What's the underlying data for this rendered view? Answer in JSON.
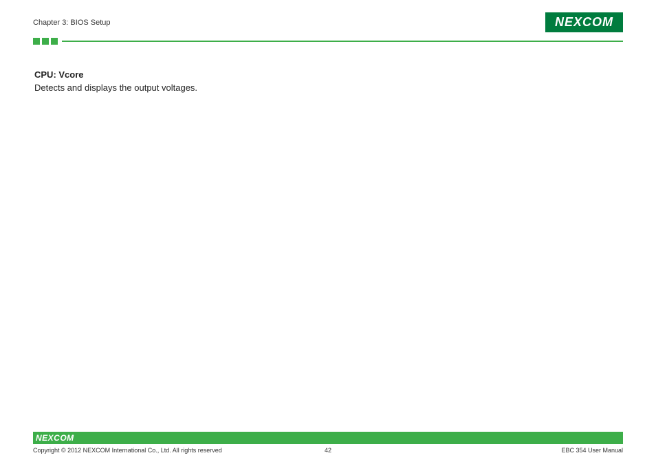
{
  "header": {
    "chapter": "Chapter 3: BIOS Setup",
    "logo_text": "NEXCOM"
  },
  "content": {
    "section_title": "CPU: Vcore",
    "section_description": "Detects and displays the output voltages."
  },
  "footer": {
    "logo_text": "NEXCOM",
    "copyright": "Copyright © 2012 NEXCOM International Co., Ltd. All rights reserved",
    "page_number": "42",
    "manual": "EBC 354 User Manual"
  }
}
